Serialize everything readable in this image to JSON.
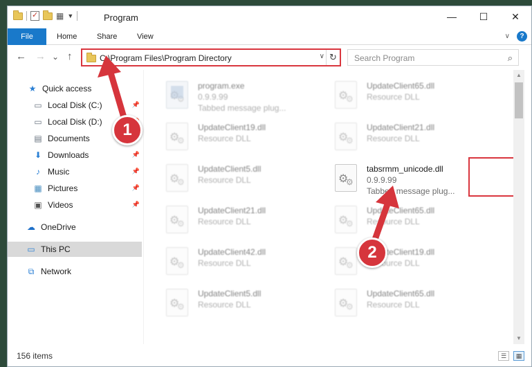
{
  "window": {
    "title": "Program",
    "controls": {
      "minimize": "—",
      "maximize": "☐",
      "close": "✕"
    }
  },
  "ribbon": {
    "tabs": [
      "File",
      "Home",
      "Share",
      "View"
    ],
    "help": "?"
  },
  "nav": {
    "back": "←",
    "forward": "→",
    "recent": "⌄",
    "up": "↑"
  },
  "address": {
    "path": "C:\\Program Files\\Program Directory",
    "refresh": "↻"
  },
  "search": {
    "placeholder": "Search Program",
    "icon": "⌕"
  },
  "sidebar": {
    "items": [
      {
        "label": "Quick access",
        "icon": "★",
        "color": "#2a7fd4"
      },
      {
        "label": "Local Disk (C:)",
        "icon": "▭",
        "color": "#6a7480",
        "pinned": true
      },
      {
        "label": "Local Disk (D:)",
        "icon": "▭",
        "color": "#6a7480",
        "pinned": true
      },
      {
        "label": "Documents",
        "icon": "▤",
        "color": "#6a7480",
        "pinned": true
      },
      {
        "label": "Downloads",
        "icon": "⬇",
        "color": "#2a7fd4",
        "pinned": true
      },
      {
        "label": "Music",
        "icon": "♪",
        "color": "#2a7fd4",
        "pinned": true
      },
      {
        "label": "Pictures",
        "icon": "▦",
        "color": "#4a8fc0",
        "pinned": true
      },
      {
        "label": "Videos",
        "icon": "▣",
        "color": "#555",
        "pinned": true
      },
      {
        "label": "OneDrive",
        "icon": "☁",
        "color": "#1e6fc8"
      },
      {
        "label": "This PC",
        "icon": "▭",
        "color": "#2a7fd4",
        "selected": true
      },
      {
        "label": "Network",
        "icon": "⧉",
        "color": "#2a7fd4"
      }
    ]
  },
  "files": [
    {
      "name": "program.exe",
      "line2": "0.9.9.99",
      "line3": "Tabbed message plug...",
      "type": "exe"
    },
    {
      "name": "UpdateClient65.dll",
      "line2": "Resource DLL",
      "line3": ""
    },
    {
      "name": "UpdateClient19.dll",
      "line2": "Resource DLL",
      "line3": ""
    },
    {
      "name": "UpdateClient21.dll",
      "line2": "Resource DLL",
      "line3": ""
    },
    {
      "name": "UpdateClient5.dll",
      "line2": "Resource DLL",
      "line3": ""
    },
    {
      "name": "tabsrmm_unicode.dll",
      "line2": "0.9.9.99",
      "line3": "Tabbed message plug...",
      "highlighted": true
    },
    {
      "name": "UpdateClient21.dll",
      "line2": "Resource DLL",
      "line3": ""
    },
    {
      "name": "UpdateClient65.dll",
      "line2": "Resource DLL",
      "line3": ""
    },
    {
      "name": "UpdateClient42.dll",
      "line2": "Resource DLL",
      "line3": ""
    },
    {
      "name": "UpdateClient19.dll",
      "line2": "Resource DLL",
      "line3": ""
    },
    {
      "name": "UpdateClient5.dll",
      "line2": "Resource DLL",
      "line3": ""
    },
    {
      "name": "UpdateClient65.dll",
      "line2": "Resource DLL",
      "line3": ""
    }
  ],
  "status": {
    "count": "156 items"
  },
  "annotations": [
    {
      "label": "1",
      "color": "#d6353c"
    },
    {
      "label": "2",
      "color": "#d6353c"
    }
  ]
}
